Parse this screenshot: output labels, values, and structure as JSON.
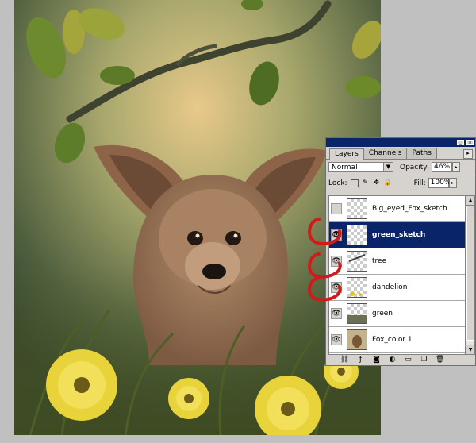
{
  "palette": {
    "tabs": [
      {
        "label": "Layers",
        "active": true
      },
      {
        "label": "Channels",
        "active": false
      },
      {
        "label": "Paths",
        "active": false
      }
    ],
    "blend_mode": "Normal",
    "opacity_label": "Opacity:",
    "opacity_value": "46%",
    "lock_label": "Lock:",
    "fill_label": "Fill:",
    "fill_value": "100%",
    "layers": [
      {
        "name": "Big_eyed_Fox_sketch",
        "visible": false,
        "selected": false
      },
      {
        "name": "green_sketch",
        "visible": true,
        "selected": true
      },
      {
        "name": "tree",
        "visible": true,
        "selected": false
      },
      {
        "name": "dandelion",
        "visible": true,
        "selected": false
      },
      {
        "name": "green",
        "visible": true,
        "selected": false
      },
      {
        "name": "Fox_color 1",
        "visible": true,
        "selected": false
      }
    ]
  },
  "icons": {
    "eye": "eye-icon",
    "menu": "palette-menu-icon",
    "link": "link-layers-icon",
    "style": "layer-style-icon",
    "mask": "layer-mask-icon",
    "adjust": "adjustment-layer-icon",
    "folder": "new-group-icon",
    "new": "new-layer-icon",
    "trash": "delete-layer-icon"
  },
  "colors": {
    "selection": "#0a246a",
    "annotation": "#d21a1a",
    "panel": "#d6d3ce"
  }
}
